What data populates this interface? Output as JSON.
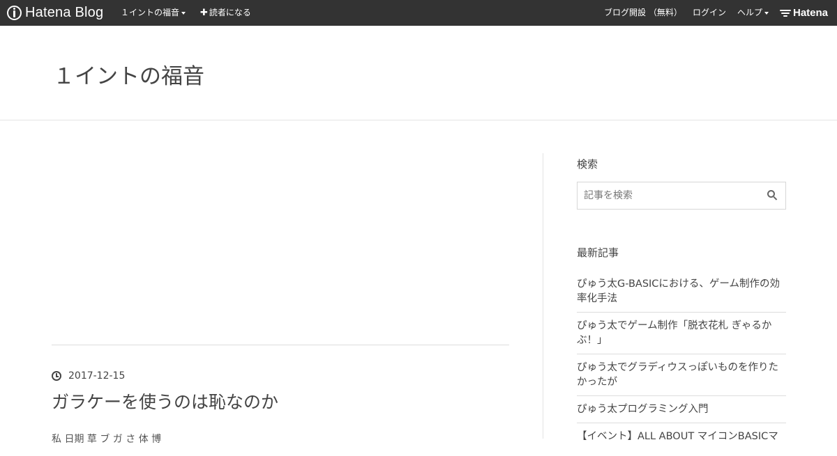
{
  "globalbar": {
    "logo_text": "Hatena Blog",
    "blog_menu_label": "１イントの福音",
    "subscribe_label": "読者になる",
    "open_blog_label": "ブログ開設 （無料）",
    "login_label": "ログイン",
    "help_label": "ヘルプ",
    "hatena_label": "Hatena"
  },
  "header": {
    "blog_title": "１イントの福音"
  },
  "entry": {
    "date": "2017-12-15",
    "title": "ガラケーを使うのは恥なのか",
    "snippet": "私 日期 草  ブ   ガ    さ  体  博"
  },
  "sidebar": {
    "search": {
      "heading": "検索",
      "placeholder": "記事を検索"
    },
    "recent": {
      "heading": "最新記事",
      "items": [
        {
          "label": "ぴゅう太G-BASICにおける、ゲーム制作の効率化手法"
        },
        {
          "label": "ぴゅう太でゲーム制作「脱衣花札 ぎゃるかぶ！」"
        },
        {
          "label": "ぴゅう太でグラディウスっぽいものを作りたかったが"
        },
        {
          "label": "ぴゅう太プログラミング入門"
        },
        {
          "label": "【イベント】ALL ABOUT マイコンBASICマ"
        }
      ]
    }
  },
  "colors": {
    "globalbar_bg": "#333333",
    "text": "#444444",
    "divider": "#e3e3e3"
  }
}
